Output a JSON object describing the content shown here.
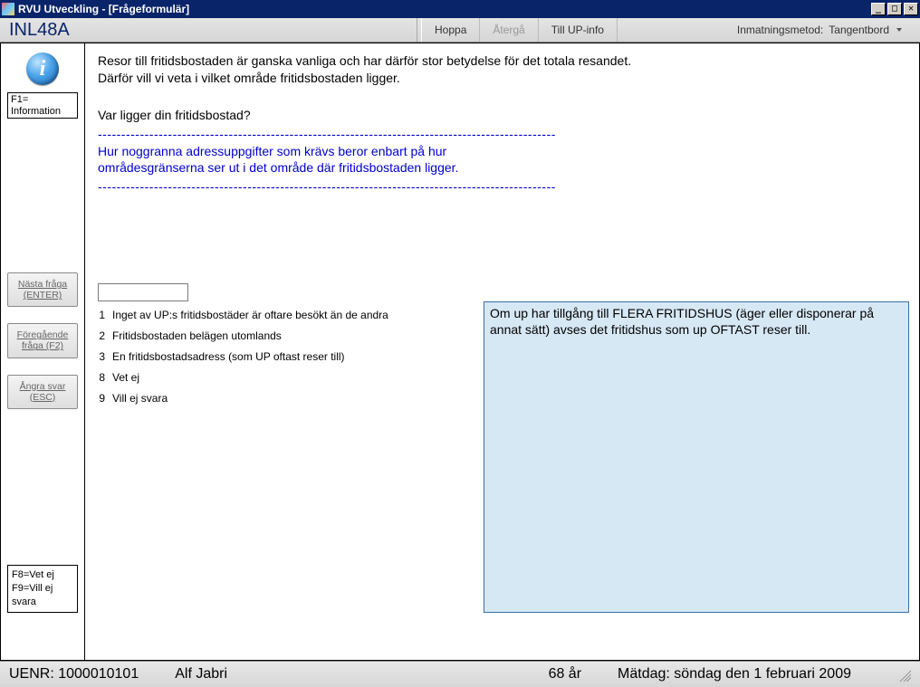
{
  "window": {
    "title": "RVU Utveckling - [Frågeformulär]"
  },
  "toolbar": {
    "code": "INL48A",
    "hoppa": "Hoppa",
    "aterga": "Återgå",
    "till_up": "Till UP-info",
    "input_method_label": "Inmatningsmetod:",
    "input_method_value": "Tangentbord"
  },
  "sidebar": {
    "info_label": "F1= Information",
    "next": "Nästa fråga (ENTER)",
    "prev": "Föregående fråga (F2)",
    "undo": "Ångra svar (ESC)",
    "hints": "F8=Vet ej\nF9=Vill ej svara"
  },
  "question": {
    "line1": "Resor till fritidsbostaden är ganska vanliga och har därför stor betydelse för det totala resandet.",
    "line2": "Därför vill vi veta i vilket område fritidsbostaden ligger.",
    "prompt": "Var ligger din fritidsbostad?",
    "dashes": "-----------------------------------------------------------------------------------------------------------",
    "note1": "Hur noggranna adressuppgifter som krävs beror enbart på hur",
    "note2": " områdesgränserna ser ut i det område där fritidsbostaden ligger."
  },
  "options": [
    {
      "num": "1",
      "text": "Inget av UP:s fritidsbostäder är oftare besökt än de andra"
    },
    {
      "num": "2",
      "text": "Fritidsbostaden belägen utomlands"
    },
    {
      "num": "3",
      "text": "En fritidsbostadsadress (som UP oftast reser till)"
    },
    {
      "num": "8",
      "text": "Vet ej"
    },
    {
      "num": "9",
      "text": "Vill ej svara"
    }
  ],
  "info_panel": {
    "text": "Om up har tillgång till FLERA FRITIDSHUS (äger eller disponerar på annat sätt) avses det fritidshus som up OFTAST reser till."
  },
  "status": {
    "uenr": "UENR: 1000010101",
    "name": "Alf Jabri",
    "age": "68 år",
    "date": "Mätdag: söndag den 1 februari 2009"
  }
}
